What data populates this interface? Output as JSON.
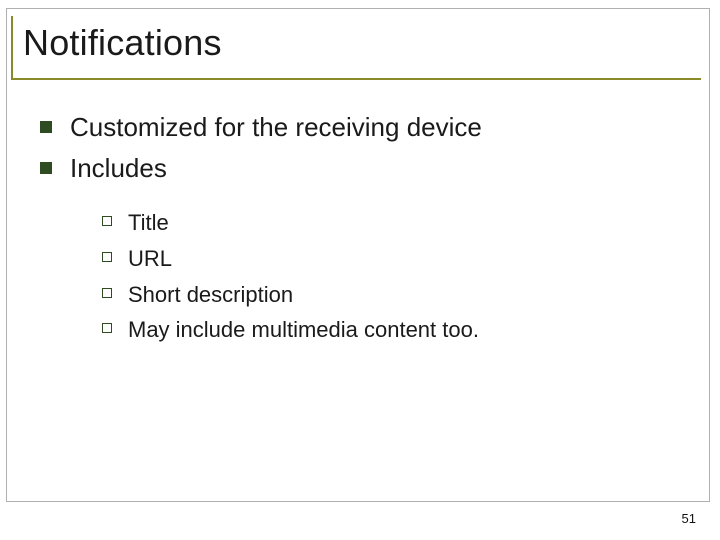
{
  "slide": {
    "title": "Notifications",
    "bullets": [
      {
        "text": "Customized for the receiving device"
      },
      {
        "text": "Includes"
      }
    ],
    "subbullets": [
      {
        "text": "Title"
      },
      {
        "text": "URL"
      },
      {
        "text": "Short description"
      },
      {
        "text": "May include multimedia content too."
      }
    ],
    "page_number": "51"
  }
}
